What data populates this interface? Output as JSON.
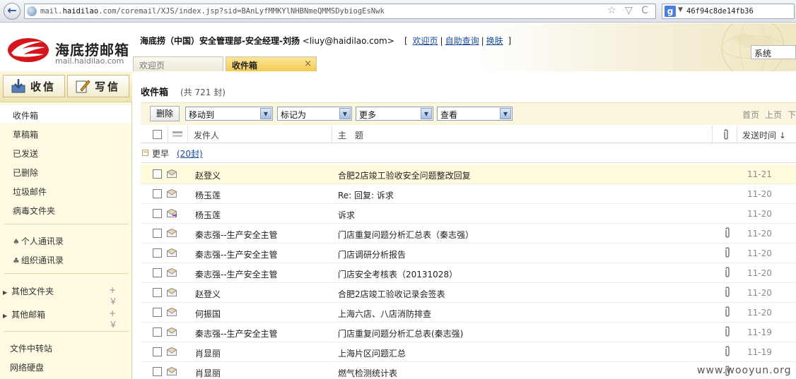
{
  "browser": {
    "url_prefix": "mail.",
    "url_host": "haidilao",
    "url_rest": ".com/coremail/XJS/index.jsp?sid=BAnLyfMMKYlNHBNmeQMMSDybiogEsNwk",
    "search_text": "46f94c8de14fb36",
    "search_engine_letter": "g"
  },
  "header": {
    "logo_cn": "海底捞邮箱",
    "logo_en": "mail.haidilao.com",
    "user_name": "海底捞（中国）安全管理部-安全经理-刘扬",
    "user_email": "<liuy@haidilao.com>",
    "link_bracket_open": "[",
    "link_welcome": "欢迎页",
    "link_help": "自助查询",
    "link_skin": "换肤",
    "link_bracket_close": "]",
    "link_sep": "|",
    "system_value": "系统"
  },
  "tabs": {
    "welcome": "欢迎页",
    "inbox": "收件箱",
    "close": "×"
  },
  "sidebar": {
    "receive_label": "收信",
    "write_label": "写信",
    "folders": [
      "收件箱",
      "草稿箱",
      "已发送",
      "已删除",
      "垃圾邮件",
      "病毒文件夹"
    ],
    "contacts": [
      "个人通讯录",
      "组织通讯录"
    ],
    "other_folders": "其他文件夹",
    "other_mailboxes": "其他邮箱",
    "group_actions": "+ ￥",
    "tools": [
      "文件中转站",
      "网络硬盘"
    ]
  },
  "main": {
    "title": "收件箱",
    "count": "(共 721 封)",
    "toolbar": {
      "delete": "删除",
      "move_to": "移动到",
      "mark_as": "标记为",
      "more": "更多",
      "view": "查看"
    },
    "pager": [
      "首页",
      "上页",
      "下页"
    ],
    "columns": {
      "sender": "发件人",
      "subject": "主　题",
      "sent_time": "发送时间 ↓"
    },
    "group": {
      "label": "更早",
      "count": "(20封)"
    },
    "messages": [
      {
        "from": "赵登义",
        "subject": "合肥2店竣工验收安全问题整改回复",
        "attach": false,
        "date": "11-21",
        "highlight": true,
        "icon": "read"
      },
      {
        "from": "杨玉莲",
        "subject": "Re: 回复: 诉求",
        "attach": false,
        "date": "11-20",
        "highlight": false,
        "icon": "read"
      },
      {
        "from": "杨玉莲",
        "subject": "诉求",
        "attach": false,
        "date": "11-20",
        "highlight": false,
        "icon": "replied"
      },
      {
        "from": "秦志强--生产安全主管",
        "subject": "门店重复问题分析汇总表（秦志强）",
        "attach": true,
        "date": "11-20",
        "highlight": false,
        "icon": "read"
      },
      {
        "from": "秦志强--生产安全主管",
        "subject": "门店调研分析报告",
        "attach": true,
        "date": "11-20",
        "highlight": false,
        "icon": "read"
      },
      {
        "from": "秦志强--生产安全主管",
        "subject": "门店安全考核表（20131028）",
        "attach": true,
        "date": "11-20",
        "highlight": false,
        "icon": "read"
      },
      {
        "from": "赵登义",
        "subject": "合肥2店竣工验收记录会签表",
        "attach": true,
        "date": "11-20",
        "highlight": false,
        "icon": "read"
      },
      {
        "from": "何振国",
        "subject": "上海六店、八店消防排查",
        "attach": true,
        "date": "11-20",
        "highlight": false,
        "icon": "read"
      },
      {
        "from": "秦志强--生产安全主管",
        "subject": "门店重复问题分析汇总表(秦志强)",
        "attach": true,
        "date": "11-19",
        "highlight": false,
        "icon": "read"
      },
      {
        "from": "肖显丽",
        "subject": "上海片区问题汇总",
        "attach": true,
        "date": "11-19",
        "highlight": false,
        "icon": "read"
      },
      {
        "from": "肖显丽",
        "subject": "燃气检测统计表",
        "attach": true,
        "date": "",
        "highlight": false,
        "icon": "read"
      }
    ]
  },
  "watermark": "www.wooyun.org"
}
